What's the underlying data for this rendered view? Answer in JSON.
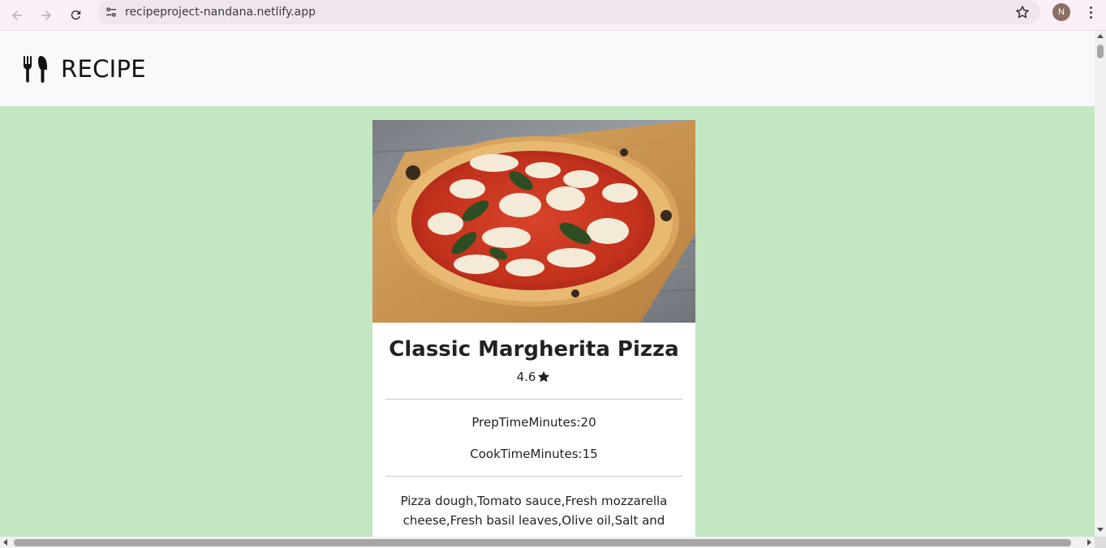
{
  "browser": {
    "url": "recipeproject-nandana.netlify.app",
    "profile_initial": "N",
    "icons": {
      "back": "arrow-left-icon",
      "forward": "arrow-right-icon",
      "reload": "reload-icon",
      "site_info": "tune-icon",
      "bookmark": "star-outline-icon",
      "menu": "kebab-menu-icon"
    }
  },
  "navbar": {
    "brand_icon": "fork-knife-icon",
    "brand_text": "RECIPE"
  },
  "recipe": {
    "image_subject": "margherita-pizza-photo",
    "name": "Classic Margherita Pizza",
    "rating": "4.6",
    "rating_icon": "star-filled-icon",
    "prep_time": "PrepTimeMinutes:20",
    "cook_time": "CookTimeMinutes:15",
    "ingredients": "Pizza dough,Tomato sauce,Fresh mozzarella cheese,Fresh basil leaves,Olive oil,Salt and pepper"
  },
  "colors": {
    "page_background": "#c3e6c3",
    "navbar_background": "#f8f9fa",
    "card_background": "#ffffff",
    "chrome_background": "#fbeff7"
  }
}
